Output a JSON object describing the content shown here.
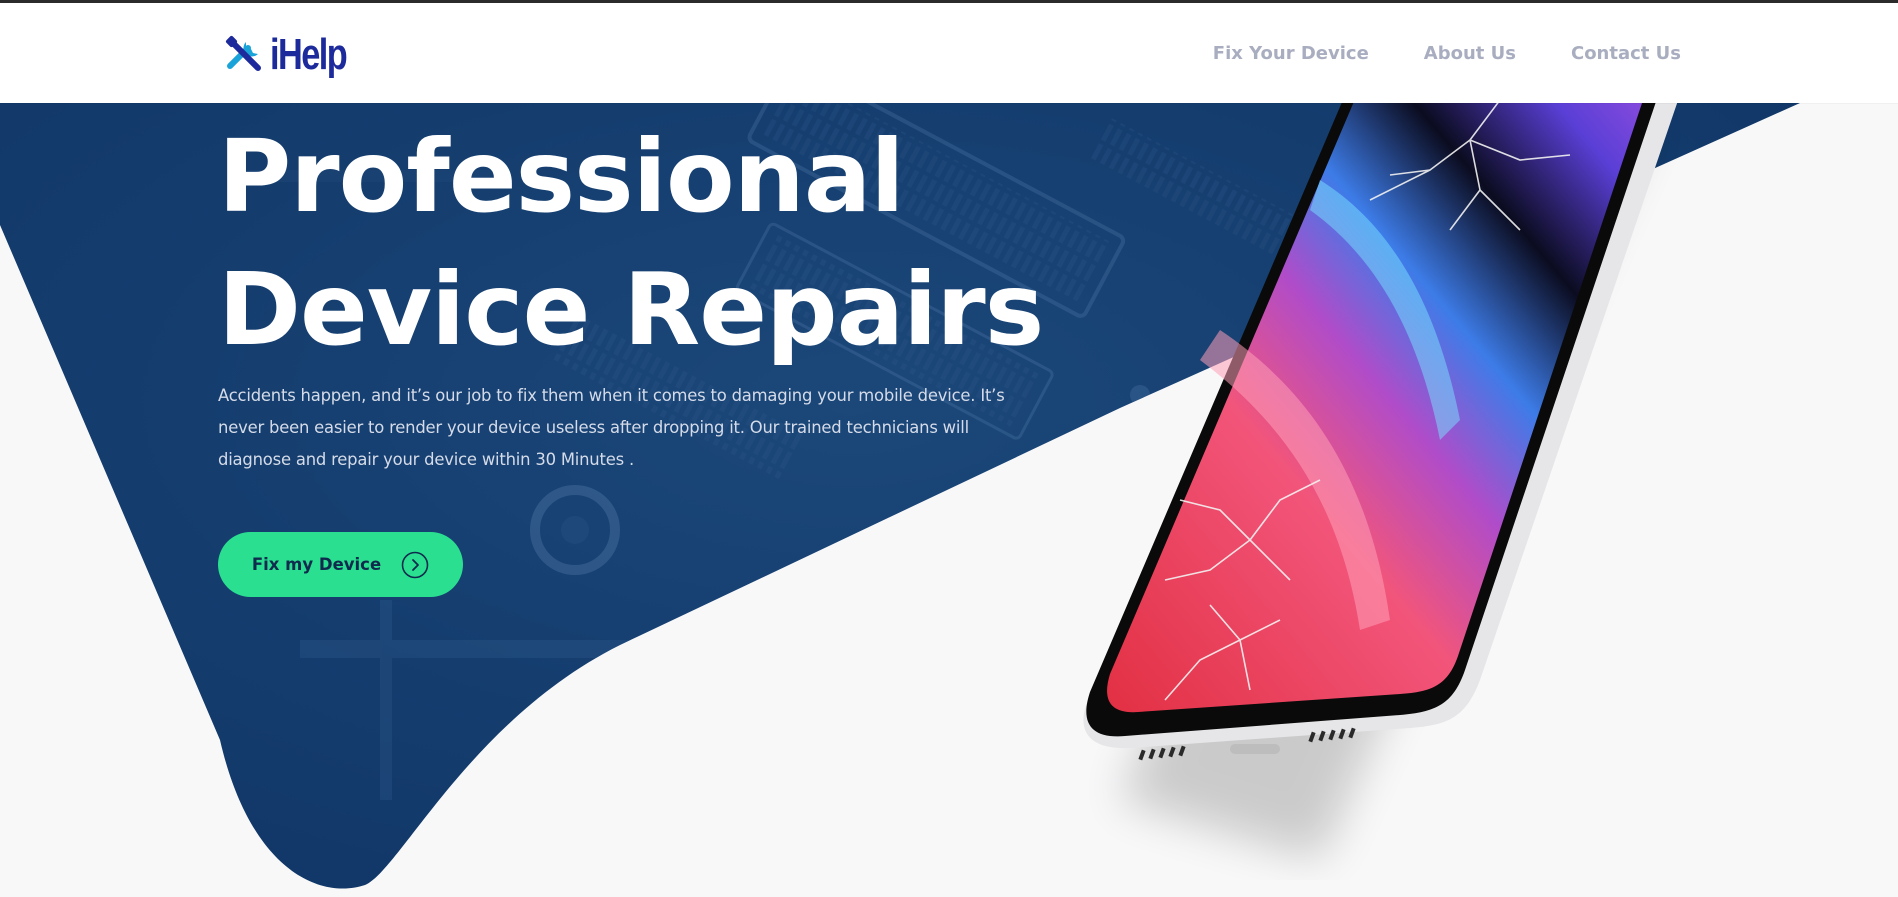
{
  "brand": {
    "name": "iHelp",
    "logo_icon": "tools-icon",
    "colors": {
      "logo_text": "#1d2a9b",
      "logo_icon": "#1aa3d9"
    }
  },
  "nav": {
    "items": [
      {
        "label": "Fix Your Device"
      },
      {
        "label": "About Us"
      },
      {
        "label": "Contact Us"
      }
    ]
  },
  "hero": {
    "title_line1": "Professional",
    "title_line2": "Device Repairs",
    "description": "Accidents happen, and it’s our job to fix them when it comes to damaging your mobile device. It’s never been easier to render your device useless after dropping it. Our trained technicians will diagnose and repair your device within 30 Minutes .",
    "cta_label": "Fix my Device",
    "cta_icon": "chevron-right-circle-icon",
    "image": "cracked-smartphone",
    "background": "circuit-board-photo"
  },
  "colors": {
    "hero_blue": "#13396a",
    "cta_green": "#2ae090",
    "nav_text": "#a9adc0",
    "page_bg": "#f8f8f9"
  }
}
